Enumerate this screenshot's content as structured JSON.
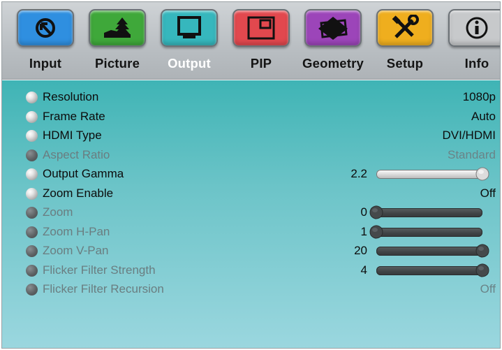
{
  "tabs": [
    {
      "key": "input",
      "label": "Input",
      "icon": "input-arrow-icon",
      "color": "#2f8fe0",
      "active": false
    },
    {
      "key": "picture",
      "label": "Picture",
      "icon": "picture-tree-icon",
      "color": "#3fa83a",
      "active": false
    },
    {
      "key": "output",
      "label": "Output",
      "icon": "output-monitor-icon",
      "color": "#36b7bd",
      "active": true
    },
    {
      "key": "pip",
      "label": "PIP",
      "icon": "pip-window-icon",
      "color": "#e2484e",
      "active": false
    },
    {
      "key": "geometry",
      "label": "Geometry",
      "icon": "geometry-shape-icon",
      "color": "#9c45b9",
      "active": false
    },
    {
      "key": "setup",
      "label": "Setup",
      "icon": "setup-tools-icon",
      "color": "#efae1e",
      "active": false
    },
    {
      "key": "info",
      "label": "Info",
      "icon": "info-icon",
      "color": "#c7c9cb",
      "active": false
    }
  ],
  "settings": [
    {
      "label": "Resolution",
      "enabled": true,
      "value": "1080p"
    },
    {
      "label": "Frame Rate",
      "enabled": true,
      "value": "Auto"
    },
    {
      "label": "HDMI Type",
      "enabled": true,
      "value": "DVI/HDMI"
    },
    {
      "label": "Aspect Ratio",
      "enabled": false,
      "value": "Standard"
    },
    {
      "label": "Output Gamma",
      "enabled": true,
      "number": "2.2",
      "slider_fraction": 1.0
    },
    {
      "label": "Zoom Enable",
      "enabled": true,
      "value": "Off"
    },
    {
      "label": "Zoom",
      "enabled": false,
      "number": "0",
      "slider_fraction": 0.0
    },
    {
      "label": "Zoom H-Pan",
      "enabled": false,
      "number": "1",
      "slider_fraction": 0.0
    },
    {
      "label": "Zoom V-Pan",
      "enabled": false,
      "number": "20",
      "slider_fraction": 1.0
    },
    {
      "label": "Flicker Filter Strength",
      "enabled": false,
      "number": "4",
      "slider_fraction": 1.0
    },
    {
      "label": "Flicker Filter Recursion",
      "enabled": false,
      "value": "Off"
    }
  ]
}
